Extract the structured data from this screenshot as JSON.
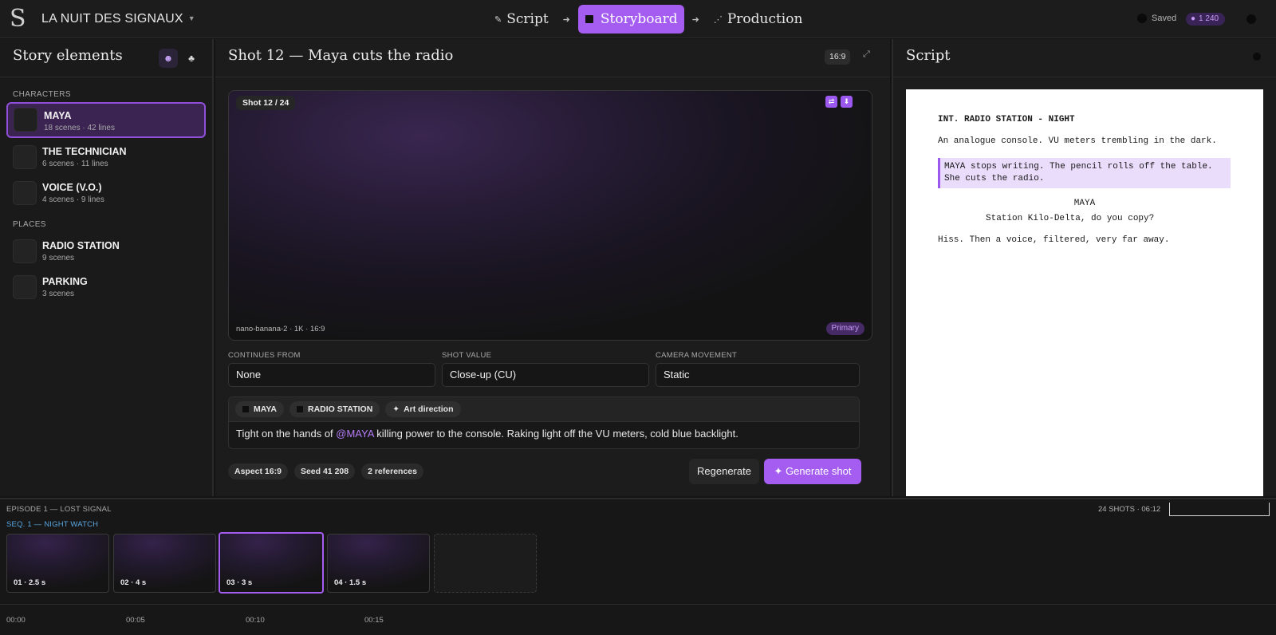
{
  "app": {
    "project_name": "LA NUIT DES SIGNAUX",
    "logo_glyph": "S",
    "steps": [
      {
        "label": "Script",
        "icon": "pen-icon"
      },
      {
        "label": "Storyboard",
        "icon": "square-icon",
        "active": true
      },
      {
        "label": "Production",
        "icon": "nodes-icon"
      }
    ],
    "save_status": "Saved",
    "credits": "1 240"
  },
  "story_elements": {
    "title": "Story elements",
    "sections": [
      {
        "label": "CHARACTERS",
        "items": [
          {
            "name": "MAYA",
            "meta": "18 scenes · 42 lines",
            "selected": true
          },
          {
            "name": "THE TECHNICIAN",
            "meta": "6 scenes · 11 lines"
          },
          {
            "name": "VOICE (V.O.)",
            "meta": "4 scenes · 9 lines"
          }
        ]
      },
      {
        "label": "PLACES",
        "items": [
          {
            "name": "RADIO STATION",
            "meta": "9 scenes"
          },
          {
            "name": "PARKING",
            "meta": "3 scenes"
          }
        ]
      }
    ]
  },
  "shot": {
    "title": "Shot 12 — Maya cuts the radio",
    "aspect_badge": "16:9",
    "counter": "Shot 12 / 24",
    "model_info": "nano-banana-2 · 1K · 16:9",
    "primary_label": "Primary",
    "fields": [
      {
        "label": "CONTINUES FROM",
        "value": "None"
      },
      {
        "label": "SHOT VALUE",
        "value": "Close-up (CU)"
      },
      {
        "label": "CAMERA MOVEMENT",
        "value": "Static"
      }
    ],
    "tags": [
      "MAYA",
      "RADIO STATION",
      "Art direction"
    ],
    "prompt_before": "Tight on the hands of ",
    "prompt_mention": "@MAYA",
    "prompt_after": " killing power to the console. Raking light off the VU meters, cold blue backlight.",
    "chips": [
      "Aspect 16:9",
      "Seed 41 208",
      "2 references"
    ],
    "regenerate_label": "Regenerate",
    "generate_label": "Generate shot"
  },
  "script": {
    "title": "Script",
    "slugline": "INT. RADIO STATION - NIGHT",
    "action1": "An analogue console. VU meters trembling in the dark.",
    "highlight_line1": "MAYA stops writing. The pencil rolls off the table.",
    "highlight_line2": "She cuts the radio.",
    "character": "MAYA",
    "dialogue": "Station Kilo-Delta, do you copy?",
    "action2": "Hiss. Then a voice, filtered, very far away."
  },
  "timeline": {
    "episode": "EPISODE 1 — LOST SIGNAL",
    "summary": "24 SHOTS · 06:12",
    "sequence": "SEQ. 1 — NIGHT WATCH",
    "clips": [
      {
        "label": "01 · 2.5 s"
      },
      {
        "label": "02 · 4 s"
      },
      {
        "label": "03 · 3 s",
        "selected": true
      },
      {
        "label": "04 · 1.5 s"
      }
    ],
    "ruler": [
      "00:00",
      "00:05",
      "00:10",
      "00:15"
    ]
  },
  "colors": {
    "accent": "#a55cf0",
    "mention": "#b57cf7",
    "sequence": "#58a6e0"
  }
}
